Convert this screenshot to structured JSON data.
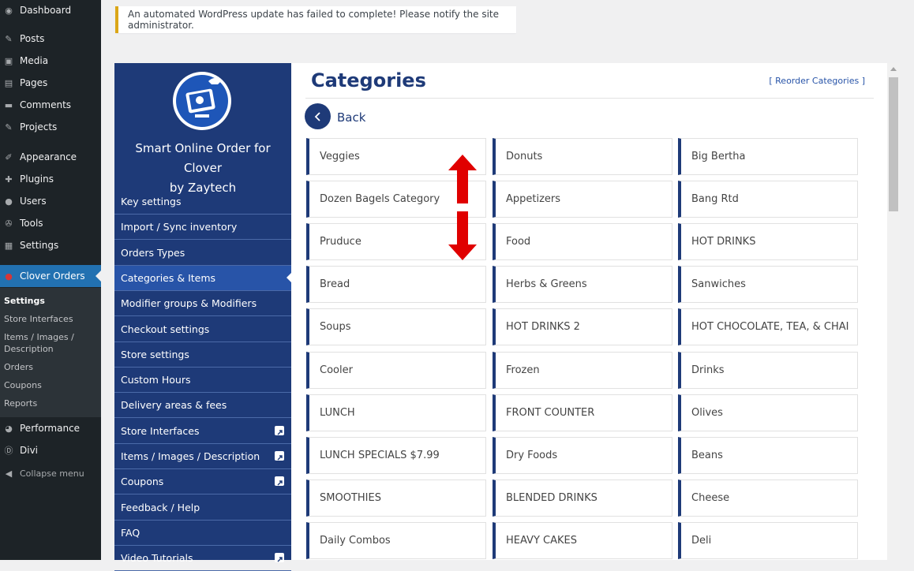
{
  "wp_sidebar": {
    "items": [
      {
        "label": "Dashboard",
        "icon": "dashboard-icon"
      },
      {
        "label": "Posts",
        "icon": "pin-icon"
      },
      {
        "label": "Media",
        "icon": "media-icon"
      },
      {
        "label": "Pages",
        "icon": "pages-icon"
      },
      {
        "label": "Comments",
        "icon": "comment-icon"
      },
      {
        "label": "Projects",
        "icon": "pin-icon"
      },
      {
        "label": "Appearance",
        "icon": "brush-icon"
      },
      {
        "label": "Plugins",
        "icon": "plugin-icon"
      },
      {
        "label": "Users",
        "icon": "user-icon"
      },
      {
        "label": "Tools",
        "icon": "wrench-icon"
      },
      {
        "label": "Settings",
        "icon": "settings-icon"
      },
      {
        "label": "Clover Orders",
        "icon": "clover-icon"
      },
      {
        "label": "Performance",
        "icon": "performance-icon"
      },
      {
        "label": "Divi",
        "icon": "divi-icon"
      },
      {
        "label": "Collapse menu",
        "icon": "collapse-icon"
      }
    ],
    "submenu": [
      "Settings",
      "Store Interfaces",
      "Items / Images / Description",
      "Orders",
      "Coupons",
      "Reports"
    ]
  },
  "notice": {
    "text": "An automated WordPress update has failed to complete! Please notify the site administrator."
  },
  "plugin": {
    "title_line1": "Smart Online Order for Clover",
    "title_line2": "by Zaytech",
    "nav": [
      {
        "label": "Key settings"
      },
      {
        "label": "Import / Sync inventory"
      },
      {
        "label": "Orders Types"
      },
      {
        "label": "Categories & Items"
      },
      {
        "label": "Modifier groups & Modifiers"
      },
      {
        "label": "Checkout settings"
      },
      {
        "label": "Store settings"
      },
      {
        "label": "Custom Hours"
      },
      {
        "label": "Delivery areas & fees"
      },
      {
        "label": "Store Interfaces"
      },
      {
        "label": "Items / Images / Description"
      },
      {
        "label": "Coupons"
      },
      {
        "label": "Feedback / Help"
      },
      {
        "label": "FAQ"
      },
      {
        "label": "Video Tutorials"
      }
    ]
  },
  "page": {
    "title": "Categories",
    "reorder_link": "[ Reorder Categories ]",
    "back_label": "Back"
  },
  "categories": [
    "Veggies",
    "Donuts",
    "Big Bertha",
    "Dozen Bagels Category",
    "Appetizers",
    "Bang Rtd",
    "Pruduce",
    "Food",
    "HOT DRINKS",
    "Bread",
    "Herbs & Greens",
    "Sanwiches",
    "Soups",
    "HOT DRINKS 2",
    "HOT CHOCOLATE, TEA, & CHAI",
    "Cooler",
    "Frozen",
    "Drinks",
    "LUNCH",
    "FRONT COUNTER",
    "Olives",
    "LUNCH SPECIALS $7.99",
    "Dry Foods",
    "Beans",
    "SMOOTHIES",
    "BLENDED DRINKS",
    "Cheese",
    "Daily Combos",
    "HEAVY CAKES",
    "Deli"
  ],
  "colors": {
    "brand_navy": "#1e3a78",
    "active_nav": "#2854a8",
    "wp_active": "#2271b1",
    "arrow_red": "#e00000"
  }
}
